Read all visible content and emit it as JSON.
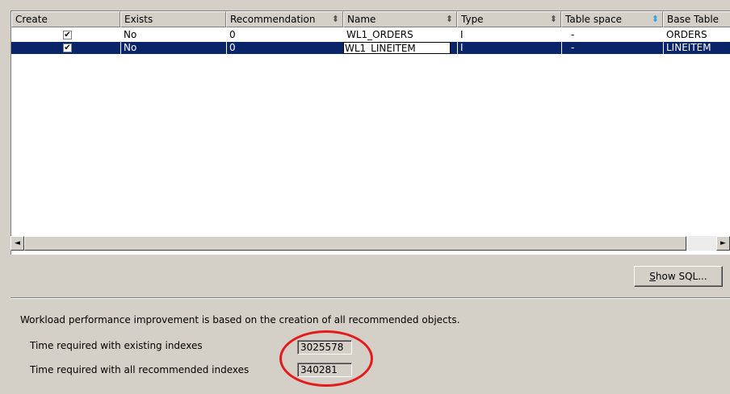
{
  "table": {
    "columns": [
      {
        "label": "Create",
        "sort": false
      },
      {
        "label": "Exists",
        "sort": false
      },
      {
        "label": "Recommendation",
        "sort": true
      },
      {
        "label": "Name",
        "sort": true
      },
      {
        "label": "Type",
        "sort": true
      },
      {
        "label": "Table space",
        "sort": true,
        "active": true
      },
      {
        "label": "Base Table",
        "sort": false
      }
    ],
    "rows": [
      {
        "create": true,
        "exists": "No",
        "recommendation": "0",
        "name": "WL1_ORDERS",
        "type": "I",
        "table_space": "-",
        "base_table": "ORDERS",
        "selected": false
      },
      {
        "create": true,
        "exists": "No",
        "recommendation": "0",
        "name": "WL1_LINEITEM",
        "type": "I",
        "table_space": "-",
        "base_table": "LINEITEM",
        "selected": true
      }
    ],
    "sort_glyph": "⬍"
  },
  "scrollbar": {
    "left_arrow": "◄",
    "right_arrow": "►"
  },
  "show_sql_button": {
    "prefix": "",
    "mnemonic": "S",
    "rest": "how SQL..."
  },
  "info": {
    "text": "Workload performance improvement is based on the creation of all recommended objects.",
    "existing_label": "Time required with existing indexes",
    "existing_value": "3025578",
    "recommended_label": "Time required with all recommended indexes",
    "recommended_value": "340281"
  },
  "colors": {
    "highlight": "#e41b1b",
    "selection": "#0a246a",
    "sort_active": "#33a1d6"
  }
}
